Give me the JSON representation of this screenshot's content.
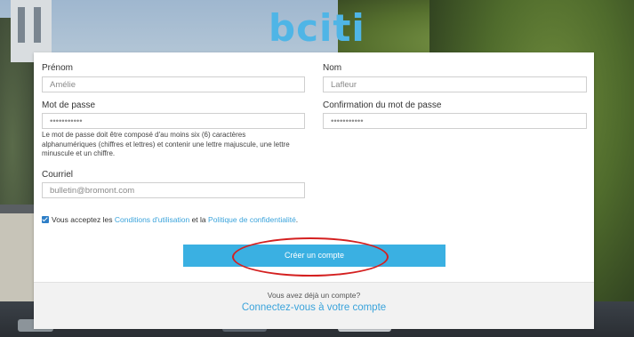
{
  "brand": {
    "logo_text": "bciti",
    "accent": "#3ab0e2"
  },
  "form": {
    "first_name": {
      "label": "Prénom",
      "value": "Amélie"
    },
    "last_name": {
      "label": "Nom",
      "value": "Lafleur"
    },
    "password": {
      "label": "Mot de passe",
      "value": "•••••••••••"
    },
    "password_confirm": {
      "label": "Confirmation du mot de passe",
      "value": "•••••••••••"
    },
    "password_help": "Le mot de passe doit être composé d'au moins six (6) caractères alphanumériques (chiffres et lettres) et contenir une lettre majuscule, une lettre minuscule et un chiffre.",
    "email": {
      "label": "Courriel",
      "value": "bulletin@bromont.com"
    },
    "terms": {
      "checked": true,
      "prefix": "Vous acceptez les",
      "terms_link": "Conditions d'utilisation",
      "middle": "et la",
      "privacy_link": "Politique de confidentialité",
      "suffix": "."
    },
    "submit_label": "Créer un compte"
  },
  "footer": {
    "question": "Vous avez déjà un compte?",
    "login_link": "Connectez-vous à votre compte"
  },
  "annotation": {
    "color": "#d42020"
  }
}
